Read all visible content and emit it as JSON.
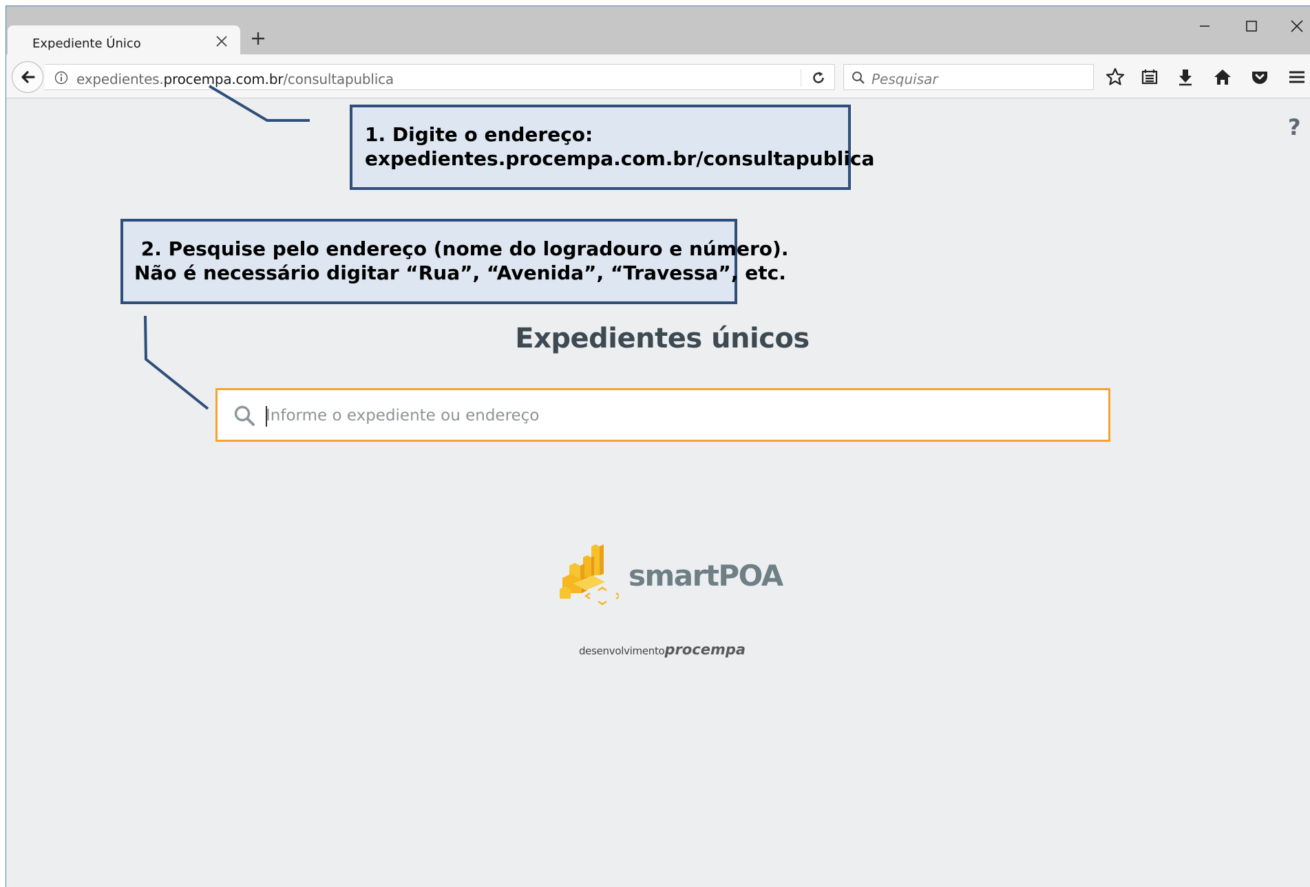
{
  "window": {
    "tab_title": "Expediente Único",
    "controls": [
      "minimize-icon",
      "maximize-icon",
      "close-icon"
    ]
  },
  "navbar": {
    "url_prefix": "expedientes.",
    "url_domain": "procempa.com.br",
    "url_path": "/consultapublica",
    "search_placeholder": "Pesquisar",
    "toolbar_icons": [
      "star-icon",
      "reading-list-icon",
      "download-icon",
      "home-icon",
      "pocket-icon",
      "menu-icon"
    ]
  },
  "page": {
    "help": "?",
    "title": "Expedientes únicos",
    "search_placeholder": "Informe o expediente ou endereço",
    "logo_text": "smartPOA",
    "credit_small": "desenvolvimento",
    "credit_brand": "procempa"
  },
  "callouts": {
    "step1": "1. Digite o endereço:\nexpedientes.procempa.com.br/consultapublica",
    "step2": " 2. Pesquise pelo endereço (nome do logradouro e número).\nNão é necessário digitar “Rua”, “Avenida”, “Travessa”, etc."
  },
  "colors": {
    "accent_orange": "#f5a22e",
    "callout_fill": "#dde6f1",
    "callout_border": "#2f4f7a",
    "page_bg": "#edeef0"
  }
}
